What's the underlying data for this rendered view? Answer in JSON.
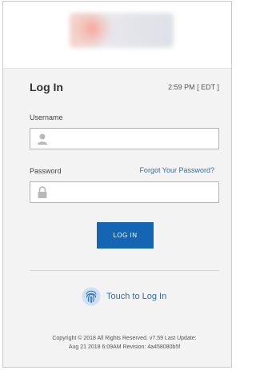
{
  "header": {
    "logo_icon": "company-logo-blurred"
  },
  "login": {
    "title": "Log In",
    "time": "2:59 PM [ EDT ]",
    "username_label": "Username",
    "username_value": "",
    "username_icon": "user-icon",
    "password_label": "Password",
    "password_value": "",
    "password_icon": "lock-icon",
    "forgot_link": "Forgot Your Password?",
    "submit_label": "LOG IN",
    "touch_label": "Touch to Log In",
    "touch_icon": "fingerprint-icon"
  },
  "footer": {
    "line1": "Copyright © 2018 All Rights Reserved. v7.59 Last Update:",
    "line2": "Aug 21 2018 6:09AM Revision: 4a458080b5f"
  },
  "colors": {
    "accent": "#1565b5",
    "link": "#2f6fad",
    "background": "#f3f3f3"
  }
}
